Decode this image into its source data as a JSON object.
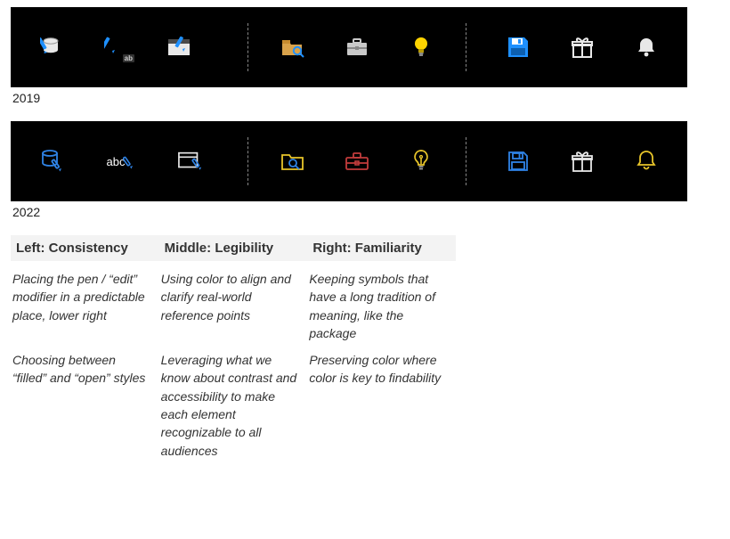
{
  "bars": {
    "y2019": {
      "label": "2019"
    },
    "y2022": {
      "label": "2022"
    }
  },
  "principles": {
    "headers": {
      "left": "Left: Consistency",
      "middle": "Middle: Legibility",
      "right": "Right: Familiarity"
    },
    "left": {
      "p1": "Placing the pen / “edit” modifier in a predictable place, lower right",
      "p2": "Choosing between “filled” and “open” styles"
    },
    "middle": {
      "p1": "Using color to align and clarify real-world reference points",
      "p2": "Leveraging what we know about contrast and accessibility to make each element recognizable to all audiences"
    },
    "right": {
      "p1": "Keeping symbols that have a long tradition of meaning, like the package",
      "p2": "Preserving color where color is key to findability"
    }
  },
  "icon_labels": {
    "ab": "ab",
    "abc": "abc"
  },
  "colors": {
    "blue_2019": "#1e90ff",
    "blue_2022": "#2f83e6",
    "yellow_2019": "#ffd400",
    "yellow_2022": "#e8c52a",
    "folder_2019": "#d9a24a",
    "folder_2022_outline": "#e8c52a",
    "red_lines": "#c23c3c",
    "white": "#ffffff",
    "grey_fill": "#c9c9c9"
  }
}
